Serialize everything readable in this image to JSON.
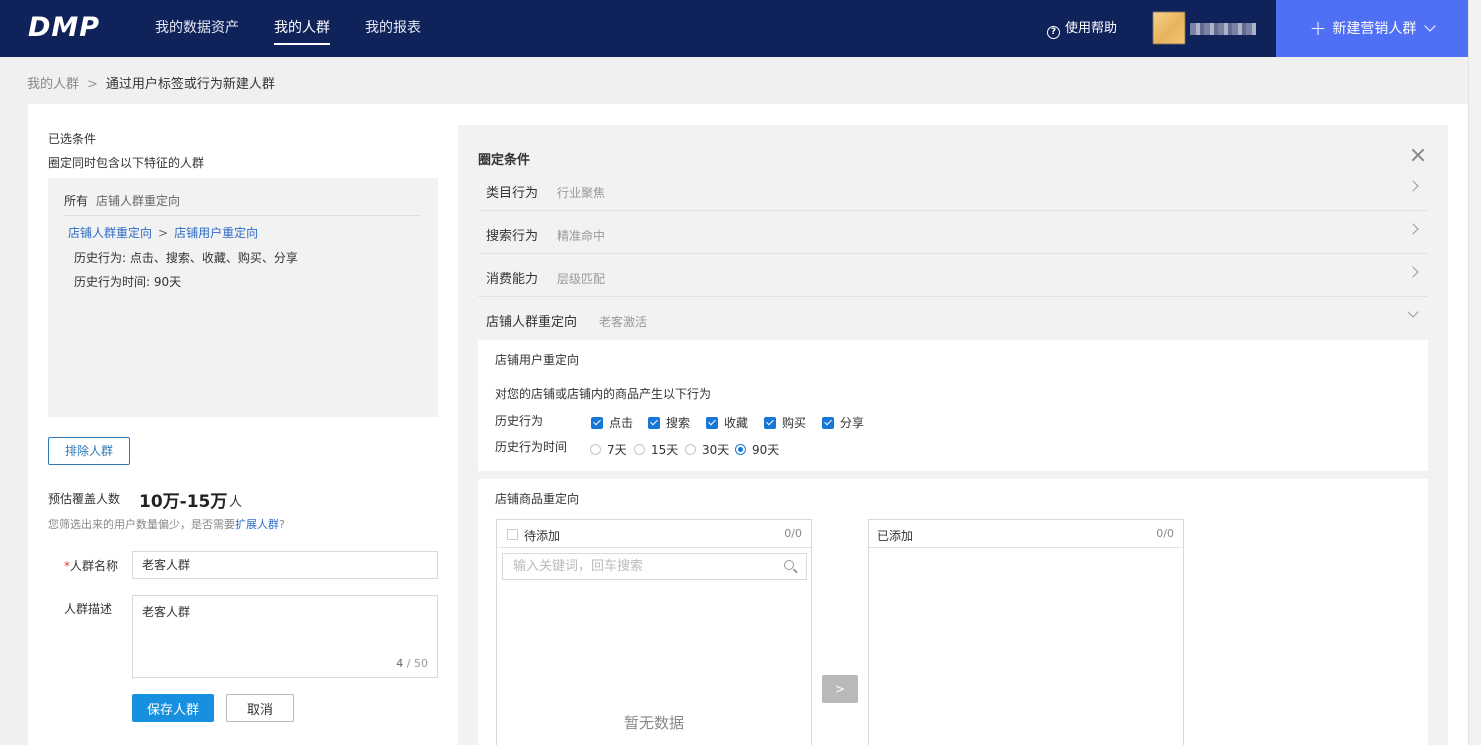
{
  "header": {
    "logo": "DMP",
    "nav": [
      {
        "label": "我的数据资产"
      },
      {
        "label": "我的人群"
      },
      {
        "label": "我的报表"
      }
    ],
    "help_label": "使用帮助",
    "new_button_label": "新建营销人群"
  },
  "breadcrumb": {
    "parent": "我的人群",
    "separator": ">",
    "current": "通过用户标签或行为新建人群"
  },
  "left": {
    "selected_title": "已选条件",
    "selected_sub": "圈定同时包含以下特征的人群",
    "cond": {
      "all_label": "所有",
      "tag": "店铺人群重定向",
      "path_a": "店铺人群重定向",
      "path_sep": ">",
      "path_b": "店铺用户重定向",
      "item1": "历史行为: 点击、搜索、收藏、购买、分享",
      "item2": "历史行为时间: 90天"
    },
    "exclude_label": "排除人群",
    "estimate": {
      "label": "预估覆盖人数",
      "value": "10万-15万",
      "unit": "人",
      "hint": "您筛选出来的用户数量偏少，是否需要",
      "hint_link": "扩展人群",
      "hint_end": "?"
    },
    "name_label": "人群名称",
    "name_required": "*",
    "name_value": "老客人群",
    "desc_label": "人群描述",
    "desc_value": "老客人群",
    "desc_count": "4",
    "desc_max": "/ 50",
    "save_label": "保存人群",
    "cancel_label": "取消"
  },
  "right": {
    "title": "圈定条件",
    "rows": [
      {
        "name": "类目行为",
        "desc": "行业聚焦"
      },
      {
        "name": "搜索行为",
        "desc": "精准命中"
      },
      {
        "name": "消费能力",
        "desc": "层级匹配"
      },
      {
        "name": "店铺人群重定向",
        "desc": "老客激活"
      }
    ],
    "user_retarget": {
      "title": "店铺用户重定向",
      "desc": "对您的店铺或店铺内的商品产生以下行为",
      "behavior_label": "历史行为",
      "behaviors": [
        "点击",
        "搜索",
        "收藏",
        "购买",
        "分享"
      ],
      "time_label": "历史行为时间",
      "times": [
        "7天",
        "15天",
        "30天",
        "90天"
      ],
      "time_selected": "90天"
    },
    "goods_retarget": {
      "title": "店铺商品重定向",
      "pending_label": "待添加",
      "pending_count": "0/0",
      "search_placeholder": "输入关键词，回车搜索",
      "empty_text": "暂无数据",
      "move_label": ">",
      "added_label": "已添加",
      "added_count": "0/0"
    }
  }
}
